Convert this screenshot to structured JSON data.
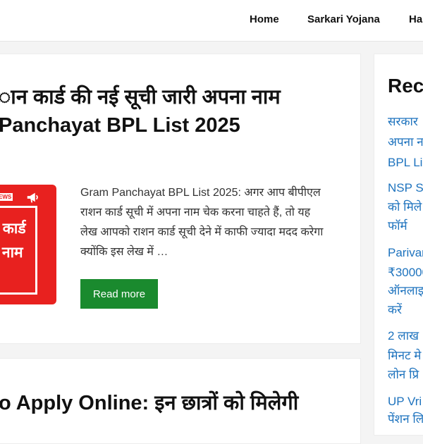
{
  "nav": {
    "items": [
      "Home",
      "Sarkari Yojana",
      "Ha"
    ]
  },
  "posts": [
    {
      "title_lines": [
        "ान कार्ड की नई सूची जारी अपना नाम",
        "Panchayat BPL List 2025"
      ],
      "thumbnail": {
        "tag": "EWS",
        "lines": [
          "ा कार्ड",
          "ना नाम"
        ],
        "icon": "megaphone-icon"
      },
      "excerpt": "Gram Panchayat BPL List 2025: अगर आप बीपीएल राशन कार्ड सूची में अपना नाम चेक करना चाहते हैं, तो यह लेख आपको राशन कार्ड सूची देने में काफी ज्यादा मदद करेगा क्योंकि इस लेख में …",
      "read_more": "Read more"
    },
    {
      "title_lines": [
        "o Apply Online: इन छात्रों को मिलेगी"
      ]
    }
  ],
  "sidebar": {
    "title": "Rec",
    "recent_posts": [
      [
        "सरकार",
        "अपना न",
        "BPL Li"
      ],
      [
        "NSP S",
        "को मिले",
        "फॉर्म"
      ],
      [
        "Parivar",
        "₹30000",
        "ऑनलाइ",
        "करें"
      ],
      [
        "2 लाख",
        "मिनट मे",
        "लोन प्रि"
      ],
      [
        "UP Vri",
        "पेंशन लि"
      ]
    ]
  },
  "colors": {
    "link": "#1e73be",
    "button": "#1a8a2e",
    "thumbnail": "#e8211f"
  }
}
